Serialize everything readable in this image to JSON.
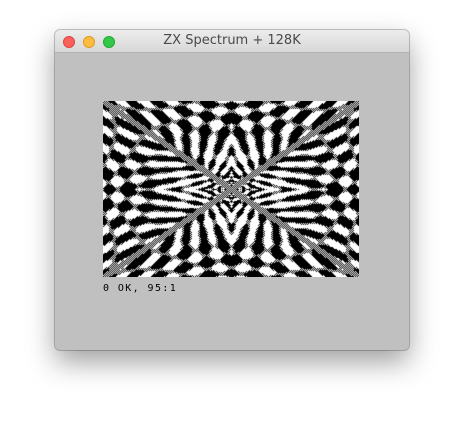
{
  "window": {
    "title": "ZX Spectrum + 128K"
  },
  "controls": {
    "close_icon": "close-icon",
    "minimize_icon": "minimize-icon",
    "zoom_icon": "zoom-icon"
  },
  "screen": {
    "status_text": "0 OK, 95:1",
    "paper_color": "#000000",
    "ink_color": "#ffffff",
    "border_color": "#c0c0c0"
  }
}
